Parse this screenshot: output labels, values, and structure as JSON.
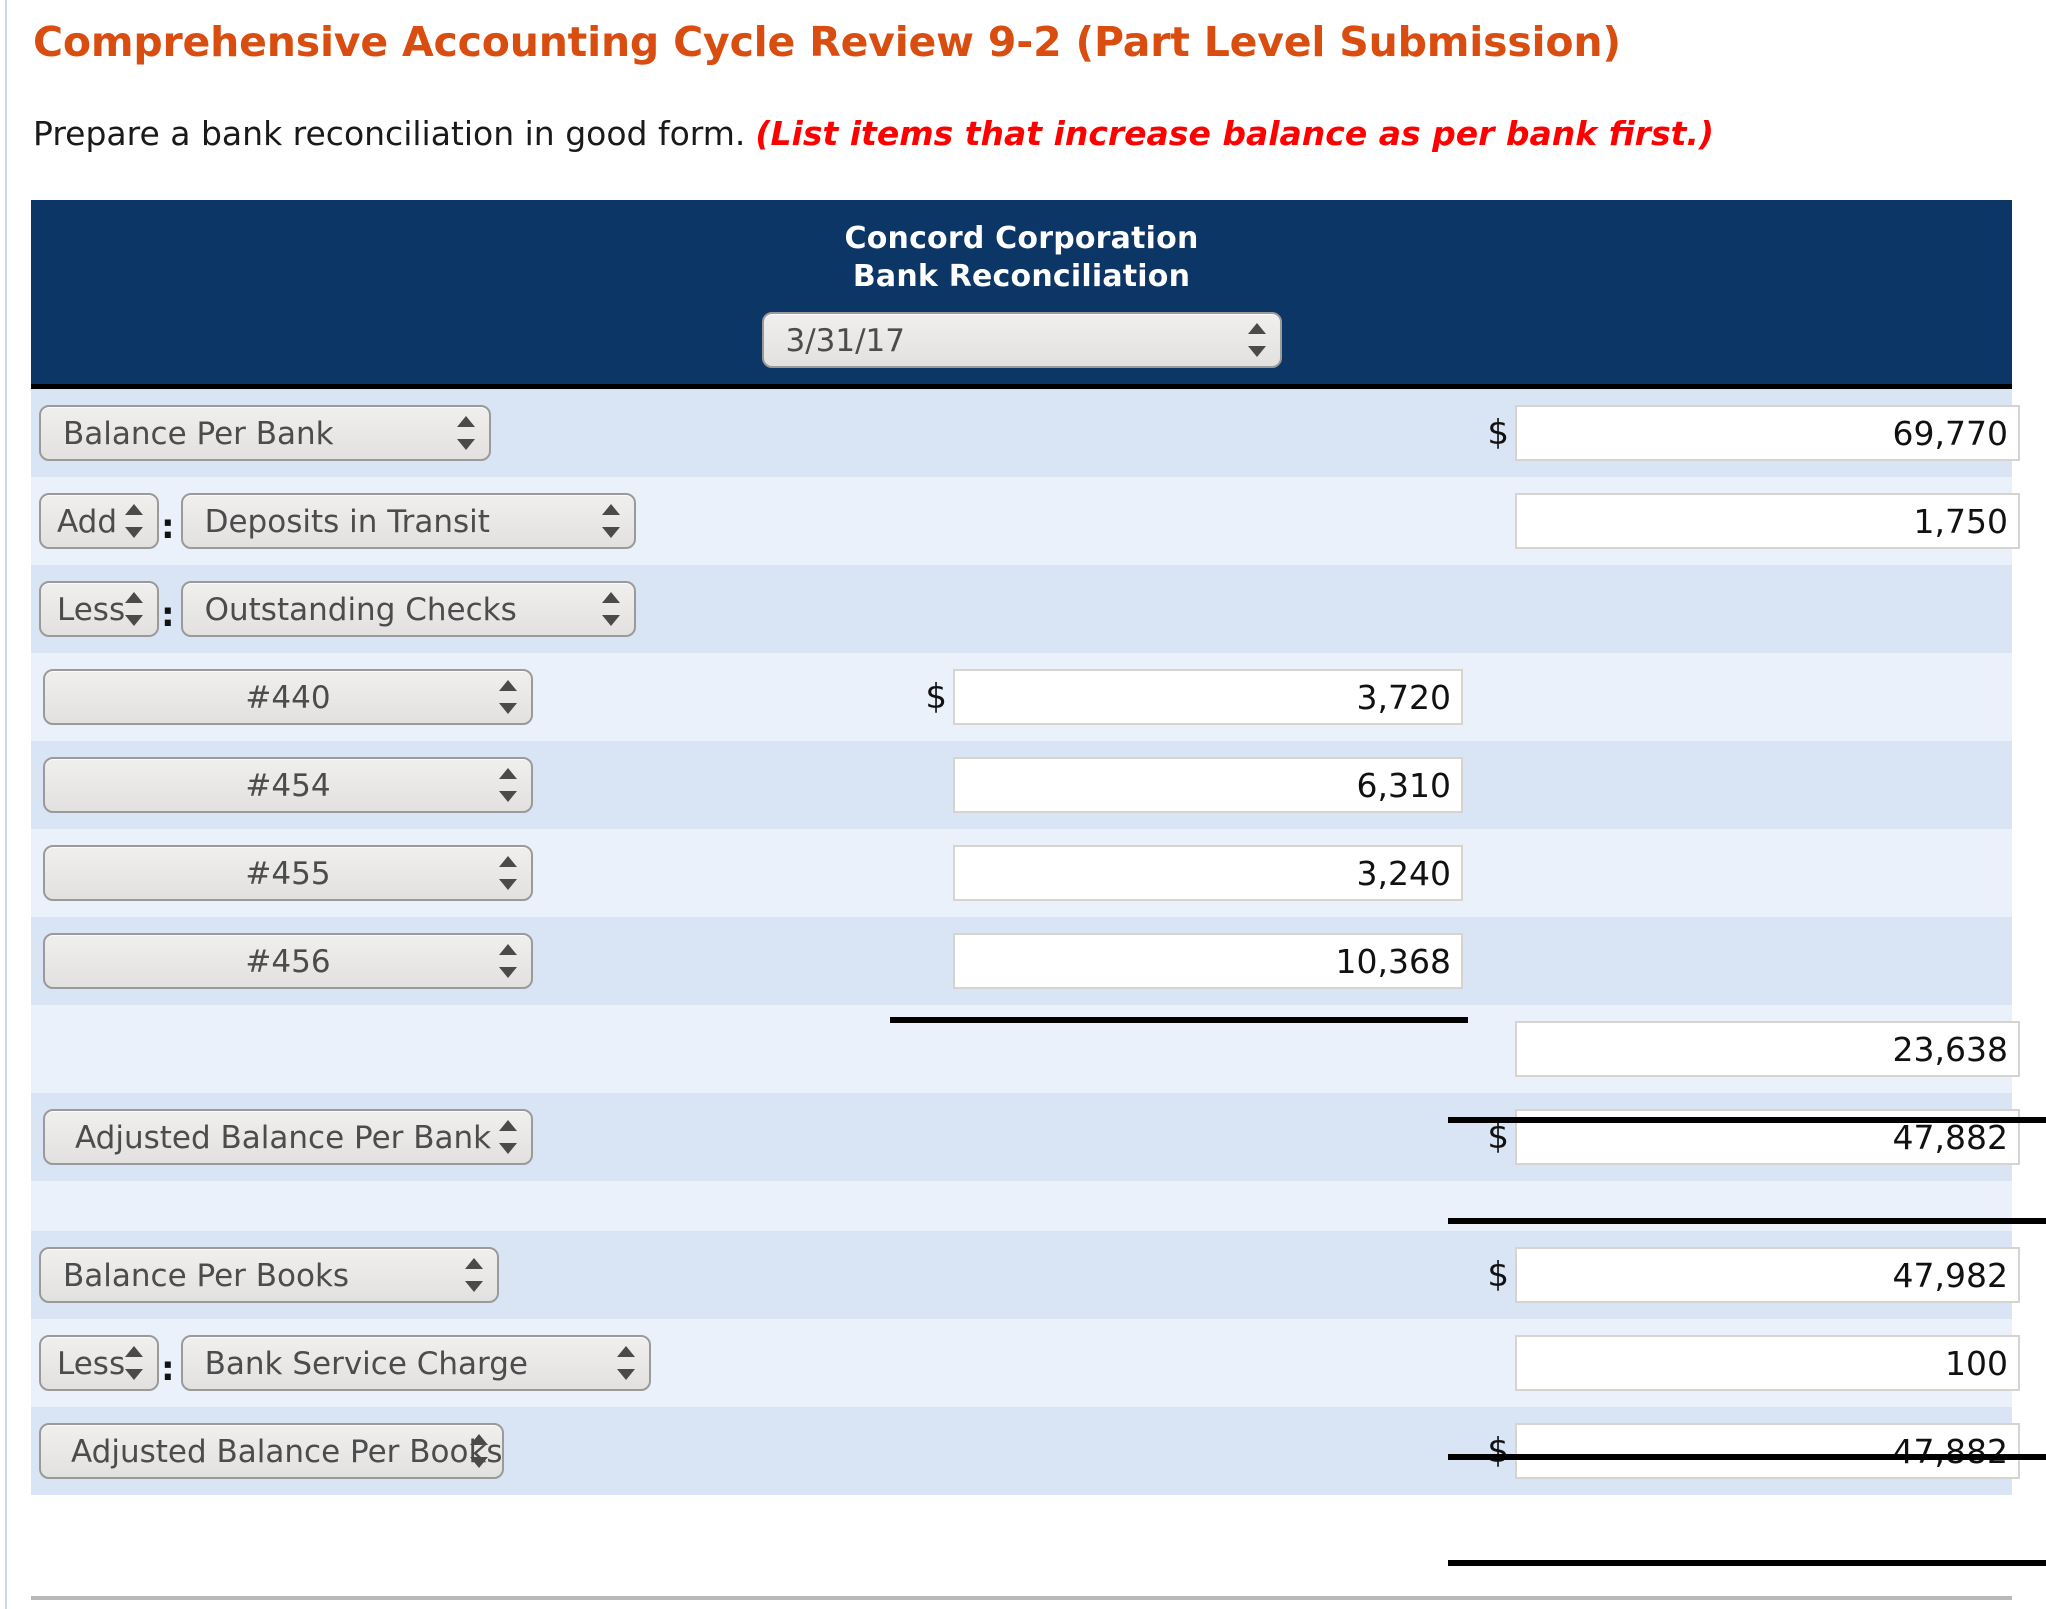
{
  "header": {
    "title": "Comprehensive Accounting Cycle Review 9-2 (Part Level Submission)",
    "instruction": "Prepare a bank reconciliation in good form.",
    "instruction_hint": "(List items that increase balance as per bank first.)",
    "title_color": "#d94d10",
    "hint_color": "#ff0000"
  },
  "statement": {
    "company": "Concord Corporation",
    "report": "Bank Reconciliation",
    "date_value": "3/31/17",
    "header_bg": "#0b3666"
  },
  "rows": {
    "balance_per_bank": {
      "label": "Balance Per Bank",
      "dollar": "$",
      "amount": "69,770"
    },
    "deposits_in_transit": {
      "operator": "Add",
      "colon": ":",
      "label": "Deposits in Transit",
      "amount": "1,750"
    },
    "outstanding_checks": {
      "operator": "Less",
      "colon": ":",
      "label": "Outstanding Checks"
    },
    "checks": [
      {
        "label": "#440",
        "dollar": "$",
        "amount": "3,720"
      },
      {
        "label": "#454",
        "dollar": "",
        "amount": "6,310"
      },
      {
        "label": "#455",
        "dollar": "",
        "amount": "3,240"
      },
      {
        "label": "#456",
        "dollar": "",
        "amount": "10,368"
      }
    ],
    "checks_total": {
      "amount": "23,638"
    },
    "adjusted_balance_per_bank": {
      "label": "Adjusted Balance Per Bank",
      "dollar": "$",
      "amount": "47,882"
    },
    "balance_per_books": {
      "label": "Balance Per Books",
      "dollar": "$",
      "amount": "47,982"
    },
    "bank_service_charge": {
      "operator": "Less",
      "colon": ":",
      "label": "Bank Service Charge",
      "amount": "100"
    },
    "adjusted_balance_per_books": {
      "label": "Adjusted Balance Per Books",
      "dollar": "$",
      "amount": "47,882"
    }
  },
  "icons": {
    "select_arrows": "up-down-stepper-icon"
  }
}
